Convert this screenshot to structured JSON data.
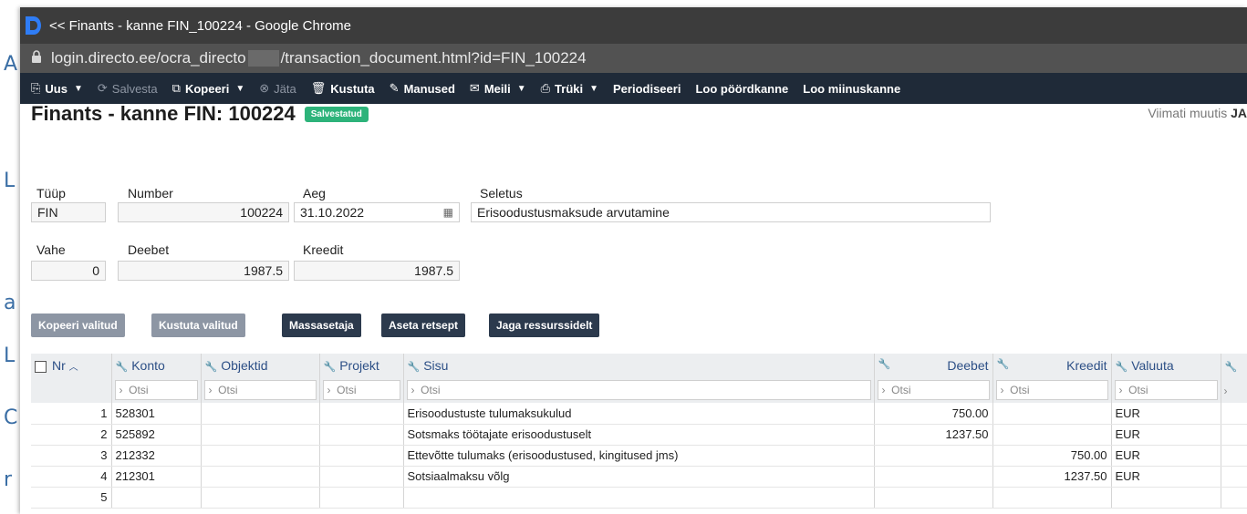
{
  "window": {
    "title": "<< Finants - kanne FIN_100224 - Google Chrome",
    "url_prefix": "login.directo.ee/ocra_directo",
    "url_suffix": "/transaction_document.html?id=FIN_100224"
  },
  "toolbar": {
    "new": "Uus",
    "save": "Salvesta",
    "copy": "Kopeeri",
    "skip": "Jäta",
    "delete": "Kustuta",
    "attachments": "Manused",
    "email": "Meili",
    "print": "Trüki",
    "periodize": "Periodiseeri",
    "reverse": "Loo pöördkanne",
    "minus": "Loo miinuskanne"
  },
  "header": {
    "title": "Finants - kanne FIN: 100224",
    "status": "Salvestatud",
    "last_modified_label": "Viimati muutis",
    "last_modified_user": "JA"
  },
  "form": {
    "type_label": "Tüüp",
    "type_value": "FIN",
    "number_label": "Number",
    "number_value": "100224",
    "time_label": "Aeg",
    "time_value": "31.10.2022",
    "desc_label": "Seletus",
    "desc_value": "Erisoodustusmaksude arvutamine",
    "diff_label": "Vahe",
    "diff_value": "0",
    "debit_label": "Deebet",
    "debit_value": "1987.5",
    "credit_label": "Kreedit",
    "credit_value": "1987.5"
  },
  "actions": {
    "copy_selected": "Kopeeri valitud",
    "delete_selected": "Kustuta valitud",
    "mass_setter": "Massasetaja",
    "set_recipe": "Aseta retsept",
    "share_resources": "Jaga ressurssidelt"
  },
  "table": {
    "filter_placeholder": "Otsi",
    "headers": {
      "nr": "Nr",
      "account": "Konto",
      "objects": "Objektid",
      "project": "Projekt",
      "content": "Sisu",
      "debit": "Deebet",
      "credit": "Kreedit",
      "currency": "Valuuta"
    },
    "rows": [
      {
        "nr": "1",
        "account": "528301",
        "objects": "",
        "project": "",
        "content": "Erisoodustuste tulumaksukulud",
        "debit": "750.00",
        "credit": "",
        "currency": "EUR"
      },
      {
        "nr": "2",
        "account": "525892",
        "objects": "",
        "project": "",
        "content": "Sotsmaks töötajate erisoodustuselt",
        "debit": "1237.50",
        "credit": "",
        "currency": "EUR"
      },
      {
        "nr": "3",
        "account": "212332",
        "objects": "",
        "project": "",
        "content": "Ettevõtte tulumaks (erisoodustused, kingitused jms)",
        "debit": "",
        "credit": "750.00",
        "currency": "EUR"
      },
      {
        "nr": "4",
        "account": "212301",
        "objects": "",
        "project": "",
        "content": "Sotsiaalmaksu võlg",
        "debit": "",
        "credit": "1237.50",
        "currency": "EUR"
      },
      {
        "nr": "5",
        "account": "",
        "objects": "",
        "project": "",
        "content": "",
        "debit": "",
        "credit": "",
        "currency": ""
      }
    ]
  },
  "colors": {
    "toolbar_bg": "#1f2a38",
    "status_badge": "#2db37a",
    "header_link": "#2c4f86"
  }
}
